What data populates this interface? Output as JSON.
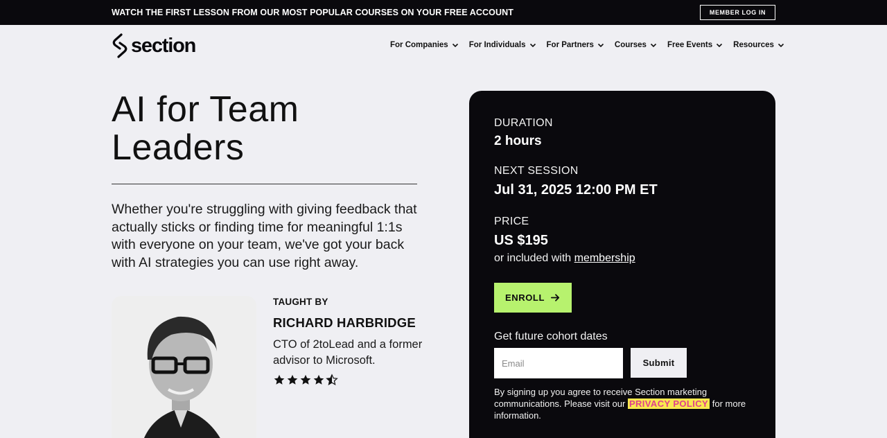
{
  "announcement": {
    "text": "WATCH THE FIRST LESSON FROM OUR MOST POPULAR COURSES ON YOUR FREE ACCOUNT",
    "member_login": "MEMBER LOG IN"
  },
  "brand": {
    "name": "section"
  },
  "nav": [
    {
      "label": "For Companies"
    },
    {
      "label": "For Individuals"
    },
    {
      "label": "For Partners"
    },
    {
      "label": "Courses"
    },
    {
      "label": "Free Events"
    },
    {
      "label": "Resources"
    }
  ],
  "course": {
    "title": "AI for Team Leaders",
    "description": "Whether you're struggling with giving feedback that actually sticks or finding time for meaningful 1:1s with everyone on your team, we've got your back with AI strategies you can use right away."
  },
  "instructor": {
    "taught_by_label": "TAUGHT BY",
    "name": "RICHARD HARBRIDGE",
    "bio": "CTO of 2toLead and a former advisor to Microsoft.",
    "rating": 4.5,
    "rating_max": 5
  },
  "card": {
    "duration_label": "DURATION",
    "duration_value": "2 hours",
    "next_session_label": "NEXT SESSION",
    "next_session_value": "Jul 31, 2025 12:00 PM ET",
    "price_label": "PRICE",
    "price_value": "US $195",
    "included_prefix": "or included with",
    "membership_link": "membership",
    "enroll_label": "ENROLL",
    "future_dates_label": "Get future cohort dates",
    "email_placeholder": "Email",
    "submit_label": "Submit",
    "consent_prefix": "By signing up you agree to receive Section marketing communications. Please visit our",
    "privacy_link": "PRIVACY POLICY",
    "consent_suffix": "for more information."
  },
  "colors": {
    "dark": "#0a090d",
    "page_bg": "#efeff3",
    "accent_green": "#b7f26e",
    "highlight_yellow": "#f8e94f",
    "privacy_pink": "#e0408a"
  },
  "icons": {
    "nav_chevron": "chevron-down-icon",
    "enroll": "arrow-right-icon",
    "rating": "star-icon"
  }
}
